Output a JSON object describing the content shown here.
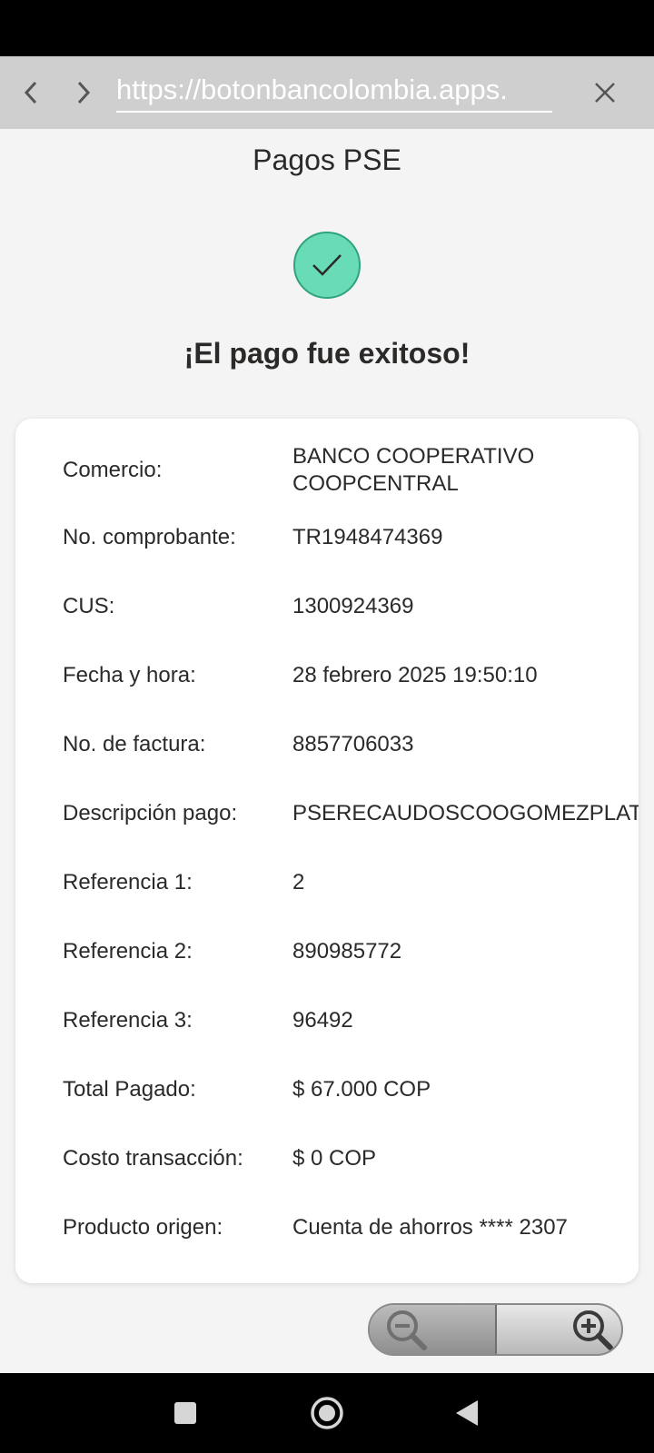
{
  "browser": {
    "url": "https://botonbancolombia.apps.",
    "back_icon": "chevron-left-icon",
    "forward_icon": "chevron-right-icon",
    "close_icon": "close-icon"
  },
  "page": {
    "title": "Pagos PSE",
    "status_icon": "check-icon",
    "success_message": "¡El pago fue exitoso!"
  },
  "receipt": {
    "rows": [
      {
        "label": "Comercio:",
        "value": "BANCO COOPERATIVO COOPCENTRAL"
      },
      {
        "label": "No. comprobante:",
        "value": "TR1948474369"
      },
      {
        "label": "CUS:",
        "value": "1300924369"
      },
      {
        "label": "Fecha y hora:",
        "value": "28 febrero 2025 19:50:10"
      },
      {
        "label": "No. de factura:",
        "value": "8857706033"
      },
      {
        "label": "Descripción pago:",
        "value": "PSERECAUDOSCOOGOMEZPLATA"
      },
      {
        "label": "Referencia 1:",
        "value": "2"
      },
      {
        "label": "Referencia 2:",
        "value": "890985772"
      },
      {
        "label": "Referencia 3:",
        "value": "96492"
      },
      {
        "label": "Total Pagado:",
        "value": "$ 67.000 COP"
      },
      {
        "label": "Costo transacción:",
        "value": "$ 0 COP"
      },
      {
        "label": "Producto origen:",
        "value": "Cuenta de ahorros **** 2307"
      }
    ]
  },
  "zoom": {
    "zoom_out_icon": "zoom-out-icon",
    "zoom_in_icon": "zoom-in-icon"
  },
  "system_nav": {
    "recents_icon": "recents-icon",
    "home_icon": "home-icon",
    "back_icon": "back-triangle-icon"
  },
  "colors": {
    "success_green": "#6adbb7",
    "browser_bar": "#cfcfcf",
    "page_background": "#f4f4f4",
    "text": "#2c2a29"
  }
}
